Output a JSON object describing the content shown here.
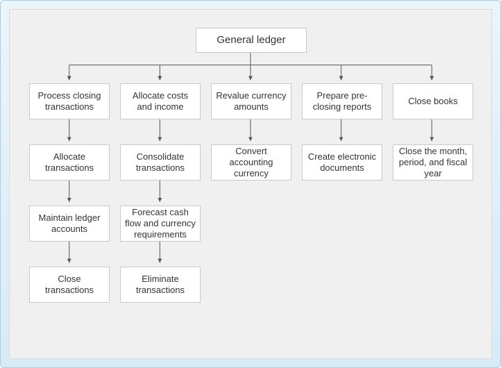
{
  "diagram": {
    "root": "General ledger",
    "columns": [
      {
        "head": "Process closing transactions",
        "items": [
          "Allocate transactions",
          "Maintain ledger accounts",
          "Close transactions"
        ]
      },
      {
        "head": "Allocate costs and income",
        "items": [
          "Consolidate transactions",
          "Forecast cash flow and currency requirements",
          "Eliminate transactions"
        ]
      },
      {
        "head": "Revalue currency amounts",
        "items": [
          "Convert accounting currency"
        ]
      },
      {
        "head": "Prepare pre-closing reports",
        "items": [
          "Create electronic documents"
        ]
      },
      {
        "head": "Close books",
        "items": [
          "Close the month, period, and fiscal year"
        ]
      }
    ]
  }
}
